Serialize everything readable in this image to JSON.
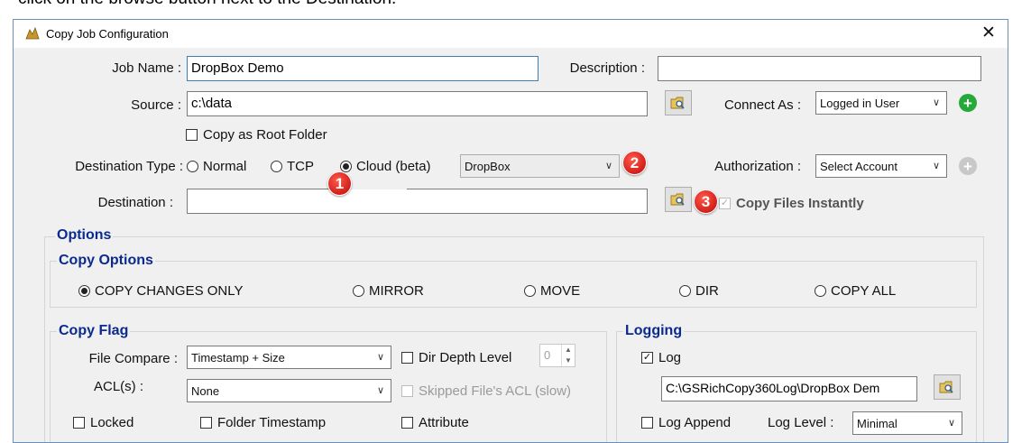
{
  "caption": "click on the browse button next to the Destination.",
  "window": {
    "title": "Copy Job Configuration",
    "close_glyph": "✕"
  },
  "labels": {
    "job_name": "Job Name :",
    "description": "Description :",
    "source": "Source :",
    "connect_as": "Connect As :",
    "destination_type": "Destination Type :",
    "authorization": "Authorization :",
    "destination": "Destination :",
    "file_compare": "File Compare :",
    "acls": "ACL(s) :"
  },
  "fields": {
    "job_name": "DropBox Demo",
    "description": "",
    "source": "c:\\data",
    "destination": "",
    "log_path": "C:\\GSRichCopy360Log\\DropBox Dem"
  },
  "combos": {
    "connect_as": "Logged in User",
    "cloud_provider": "DropBox",
    "authorization": "Select Account",
    "file_compare": "Timestamp + Size",
    "acls": "None",
    "log_level": "Minimal"
  },
  "destination_types": [
    {
      "label": "Normal",
      "selected": false
    },
    {
      "label": "TCP",
      "selected": false
    },
    {
      "label": "Cloud (beta)",
      "selected": true
    }
  ],
  "checks": {
    "copy_as_root": "Copy as Root Folder",
    "copy_files_instantly": "Copy Files Instantly",
    "dir_depth": "Dir Depth Level",
    "dir_depth_value": "0",
    "skipped_acl": "Skipped File's ACL (slow)",
    "log": "Log",
    "locked": "Locked",
    "folder_timestamp": "Folder Timestamp",
    "attribute": "Attribute",
    "log_append": "Log Append",
    "log_level_label": "Log Level :"
  },
  "sections": {
    "options": "Options",
    "copy_options": "Copy Options",
    "copy_flag": "Copy Flag",
    "logging": "Logging"
  },
  "copy_options": [
    {
      "label": "COPY CHANGES ONLY",
      "selected": true
    },
    {
      "label": "MIRROR",
      "selected": false
    },
    {
      "label": "MOVE",
      "selected": false
    },
    {
      "label": "DIR",
      "selected": false
    },
    {
      "label": "COPY ALL",
      "selected": false
    }
  ],
  "badges": [
    "1",
    "2",
    "3"
  ],
  "icons": {
    "add_connection": "plus-circle-icon",
    "add_account": "plus-circle-icon",
    "browse": "folder-search-icon",
    "window": "app-icon"
  },
  "colors": {
    "accent": "#0b2a8f",
    "badge": "#d21f1a",
    "add_green": "#27a83a",
    "add_disabled": "#c8c8c8"
  }
}
